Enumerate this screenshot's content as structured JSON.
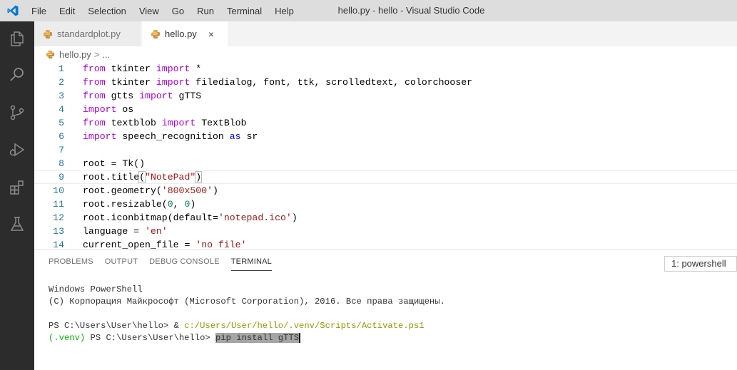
{
  "titlebar": {
    "menu": [
      "File",
      "Edit",
      "Selection",
      "View",
      "Go",
      "Run",
      "Terminal",
      "Help"
    ],
    "title": "hello.py - hello - Visual Studio Code"
  },
  "activity": [
    "explorer-icon",
    "search-icon",
    "source-control-icon",
    "run-debug-icon",
    "extensions-icon",
    "testing-icon"
  ],
  "tabs": [
    {
      "label": "standardplot.py",
      "active": false
    },
    {
      "label": "hello.py",
      "active": true,
      "close": "×"
    }
  ],
  "breadcrumb": {
    "file": "hello.py",
    "sep": ">",
    "more": "..."
  },
  "editor": {
    "lines": [
      {
        "n": "1",
        "tokens": [
          [
            "kw",
            "from"
          ],
          [
            "t",
            " tkinter "
          ],
          [
            "kw",
            "import"
          ],
          [
            "t",
            " *"
          ]
        ]
      },
      {
        "n": "2",
        "tokens": [
          [
            "kw",
            "from"
          ],
          [
            "t",
            " tkinter "
          ],
          [
            "kw",
            "import"
          ],
          [
            "t",
            " filedialog, font, ttk, scrolledtext, colorchooser"
          ]
        ]
      },
      {
        "n": "3",
        "tokens": [
          [
            "kw",
            "from"
          ],
          [
            "t",
            " gtts "
          ],
          [
            "kw",
            "import"
          ],
          [
            "t",
            " gTTS"
          ]
        ]
      },
      {
        "n": "4",
        "tokens": [
          [
            "kw",
            "import"
          ],
          [
            "t",
            " os"
          ]
        ]
      },
      {
        "n": "5",
        "tokens": [
          [
            "kw",
            "from"
          ],
          [
            "t",
            " textblob "
          ],
          [
            "kw",
            "import"
          ],
          [
            "t",
            " TextBlob"
          ]
        ]
      },
      {
        "n": "6",
        "tokens": [
          [
            "kw",
            "import"
          ],
          [
            "t",
            " speech_recognition "
          ],
          [
            "kw",
            "as"
          ],
          [
            "t",
            " sr"
          ]
        ]
      },
      {
        "n": "7",
        "tokens": []
      },
      {
        "n": "8",
        "tokens": [
          [
            "t",
            "root = Tk()"
          ]
        ]
      },
      {
        "n": "9",
        "tokens": [
          [
            "t",
            "root.title"
          ],
          [
            "br",
            "("
          ],
          [
            "str",
            "\"NotePad\""
          ],
          [
            "br",
            ")"
          ]
        ],
        "current": true
      },
      {
        "n": "10",
        "tokens": [
          [
            "t",
            "root.geometry("
          ],
          [
            "str",
            "'800x500'"
          ],
          [
            "t",
            ")"
          ]
        ]
      },
      {
        "n": "11",
        "tokens": [
          [
            "t",
            "root.resizable("
          ],
          [
            "num",
            "0"
          ],
          [
            "t",
            ", "
          ],
          [
            "num",
            "0"
          ],
          [
            "t",
            ")"
          ]
        ]
      },
      {
        "n": "12",
        "tokens": [
          [
            "t",
            "root.iconbitmap(default="
          ],
          [
            "str",
            "'notepad.ico'"
          ],
          [
            "t",
            ")"
          ]
        ]
      },
      {
        "n": "13",
        "tokens": [
          [
            "t",
            "language = "
          ],
          [
            "str",
            "'en'"
          ]
        ]
      },
      {
        "n": "14",
        "tokens": [
          [
            "t",
            "current_open_file = "
          ],
          [
            "str",
            "'no file'"
          ]
        ]
      }
    ]
  },
  "panel": {
    "tabs": [
      {
        "label": "PROBLEMS",
        "active": false
      },
      {
        "label": "OUTPUT",
        "active": false
      },
      {
        "label": "DEBUG CONSOLE",
        "active": false
      },
      {
        "label": "TERMINAL",
        "active": true
      }
    ],
    "terminal_select": "1: powershell",
    "terminal": {
      "line1": "Windows PowerShell",
      "line2": "(C) Корпорация Майкрософт (Microsoft Corporation), 2016. Все права защищены.",
      "line4_prompt": "PS C:\\Users\\User\\hello> & ",
      "line4_path": "c:/Users/User/hello/.venv/Scripts/Activate.ps1",
      "line5_env": "(.venv)",
      "line5_prompt": " PS C:\\Users\\User\\hello> ",
      "line5_cmd": "pip install gTTS"
    }
  },
  "colors": {
    "activity_bg": "#2c2c2c",
    "keyword": "#af00db",
    "string": "#a31515",
    "number": "#098658",
    "line_number": "#237893"
  }
}
